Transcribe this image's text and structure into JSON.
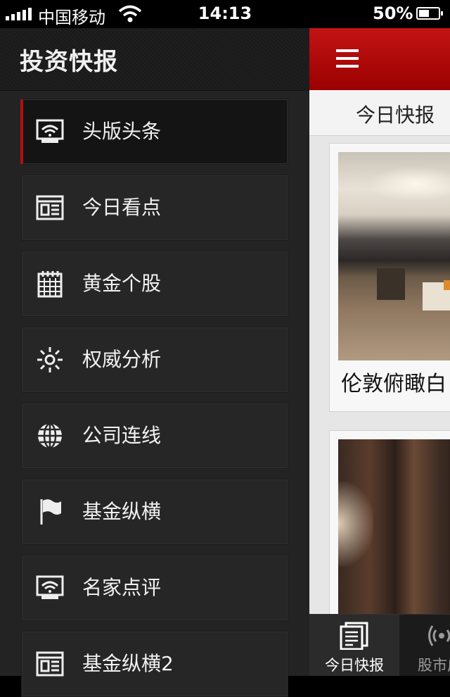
{
  "status_bar": {
    "carrier": "中国移动",
    "time": "14:13",
    "battery": "50%",
    "battery_level": 0.5
  },
  "drawer": {
    "title": "投资快报",
    "items": [
      {
        "label": "头版头条",
        "icon": "broadcast-screen-icon",
        "active": true
      },
      {
        "label": "今日看点",
        "icon": "newspaper-icon",
        "active": false
      },
      {
        "label": "黄金个股",
        "icon": "calendar-icon",
        "active": false
      },
      {
        "label": "权威分析",
        "icon": "sun-icon",
        "active": false
      },
      {
        "label": "公司连线",
        "icon": "globe-icon",
        "active": false
      },
      {
        "label": "基金纵横",
        "icon": "flag-icon",
        "active": false
      },
      {
        "label": "名家点评",
        "icon": "broadcast-screen-icon",
        "active": false
      },
      {
        "label": "基金纵横2",
        "icon": "newspaper-icon",
        "active": false
      }
    ]
  },
  "main": {
    "tab_label": "今日快报",
    "cards": [
      {
        "title": "伦敦俯瞰白"
      }
    ]
  },
  "bottom_tabs": [
    {
      "label": "今日快报",
      "icon": "news-pages-icon",
      "active": true
    },
    {
      "label": "股市广",
      "icon": "broadcast-icon",
      "active": false
    }
  ],
  "colors": {
    "accent_red": "#b40f0f",
    "drawer_bg": "#232323"
  }
}
